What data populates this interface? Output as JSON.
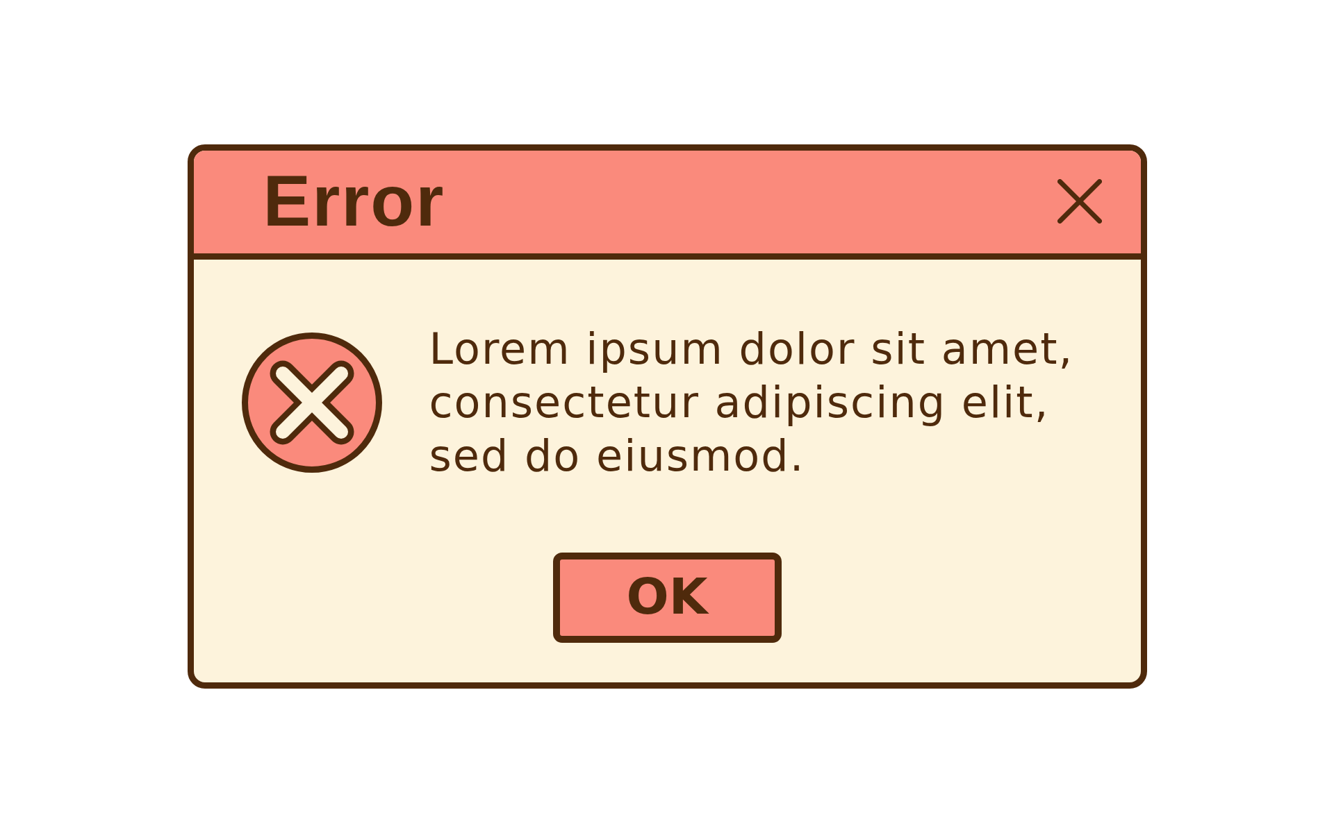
{
  "dialog": {
    "title": "Error",
    "message": "Lorem ipsum dolor sit amet, consectetur adipiscing elit, sed do eiusmod.",
    "buttons": [
      "OK"
    ]
  }
}
